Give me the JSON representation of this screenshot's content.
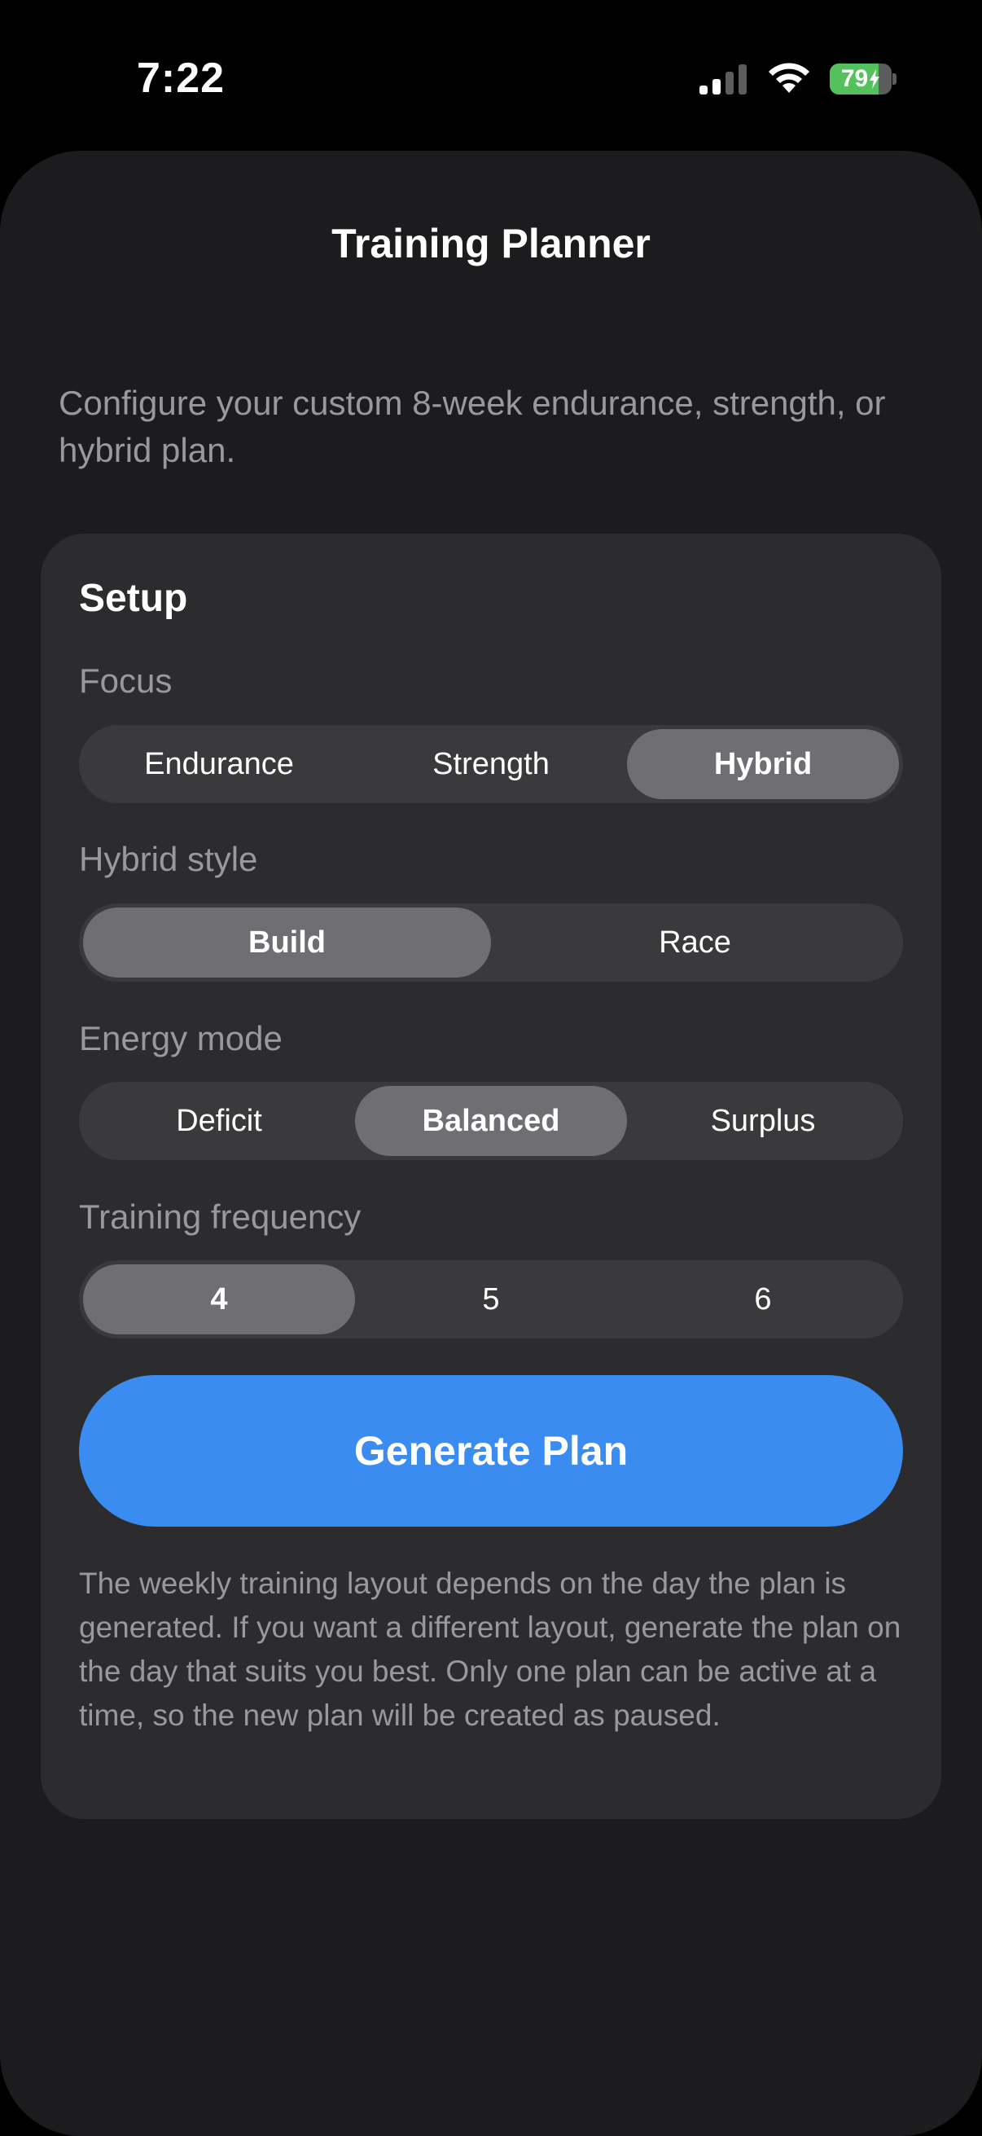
{
  "status_bar": {
    "time": "7:22",
    "battery_percent": 79,
    "battery_label": "79",
    "signal_bars_active": 2,
    "wifi": true,
    "charging": true
  },
  "nav": {
    "title": "Training Planner"
  },
  "intro": "Configure your custom 8-week endurance, strength, or hybrid plan.",
  "setup": {
    "title": "Setup",
    "focus": {
      "label": "Focus",
      "options": [
        "Endurance",
        "Strength",
        "Hybrid"
      ],
      "selected": "Hybrid"
    },
    "hybrid_style": {
      "label": "Hybrid style",
      "options": [
        "Build",
        "Race"
      ],
      "selected": "Build"
    },
    "energy_mode": {
      "label": "Energy mode",
      "options": [
        "Deficit",
        "Balanced",
        "Surplus"
      ],
      "selected": "Balanced"
    },
    "training_frequency": {
      "label": "Training frequency",
      "options": [
        "4",
        "5",
        "6"
      ],
      "selected": "4"
    },
    "generate_label": "Generate Plan",
    "note": "The weekly training layout depends on the day the plan is generated. If you want a different layout, generate the plan on the day that suits you best. Only one plan can be active at a time, so the new plan will be created as paused."
  },
  "colors": {
    "accent": "#3b8cf1",
    "battery_green": "#54c25c",
    "card_bg": "#2c2c2e",
    "sheet_bg": "#1c1c1e"
  },
  "icons": [
    "cellular-signal-icon",
    "wifi-icon",
    "battery-icon",
    "charging-bolt-icon"
  ]
}
